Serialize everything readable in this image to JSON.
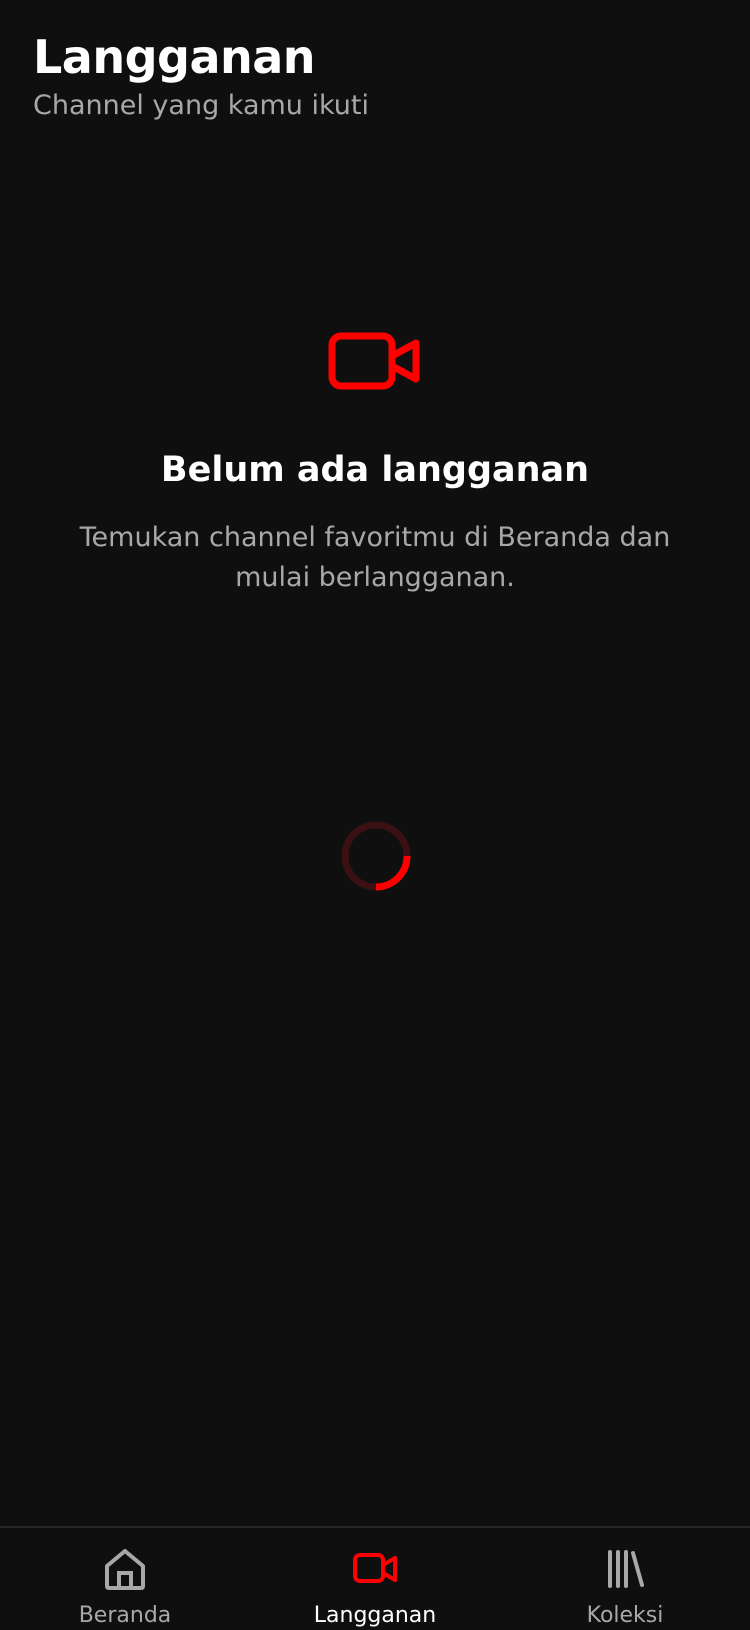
{
  "header": {
    "title": "Langganan",
    "subtitle": "Channel yang kamu ikuti"
  },
  "empty_state": {
    "icon": "video-camera-icon",
    "title": "Belum ada langganan",
    "description": "Temukan channel favoritmu di Beranda dan mulai berlangganan."
  },
  "bottom_nav": {
    "active": "Langganan",
    "items": [
      {
        "label": "Beranda",
        "icon": "home-icon"
      },
      {
        "label": "Langganan",
        "icon": "video-camera-icon"
      },
      {
        "label": "Koleksi",
        "icon": "library-icon"
      }
    ]
  },
  "colors": {
    "background": "#0f0f10",
    "accent": "#ff0000",
    "text_primary": "#ffffff",
    "text_secondary": "#a8a8a8",
    "spinner_track": "#3a1012"
  }
}
